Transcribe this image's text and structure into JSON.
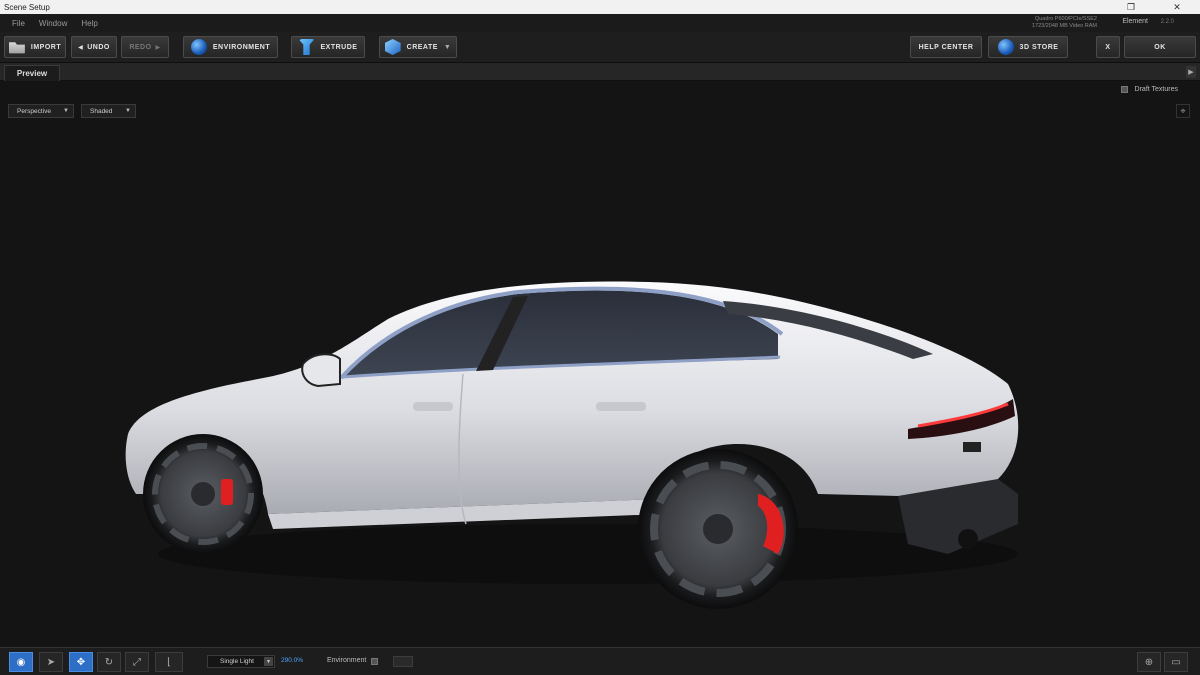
{
  "window": {
    "title": "Scene Setup",
    "restore_glyph": "❐",
    "close_glyph": "✕"
  },
  "menu": {
    "file": "File",
    "window": "Window",
    "help": "Help"
  },
  "status": {
    "gpu_line1": "Quadro P600/PCIe/SSE2",
    "gpu_line2": "1723/2048 MB Video RAM",
    "element": "Element",
    "version": "2.2.0"
  },
  "toolbar": {
    "import": "IMPORT",
    "undo": "UNDO",
    "redo": "REDO",
    "environment": "ENVIRONMENT",
    "extrude": "EXTRUDE",
    "create": "CREATE",
    "help_center": "HELP CENTER",
    "store": "3D STORE",
    "close": "X",
    "ok": "OK"
  },
  "tabs": {
    "preview": "Preview"
  },
  "viewport": {
    "draft_textures": "Draft Textures",
    "camera": "Perspective",
    "render_mode": "Shaded"
  },
  "bottom": {
    "light": "Single Light",
    "zoom": "290.0%",
    "environment": "Environment"
  },
  "icons": [
    "folder-icon",
    "globe-icon",
    "extrude-icon",
    "cube-icon",
    "camera-icon",
    "pointer-icon",
    "move-icon",
    "rotate-icon",
    "scale-icon",
    "axis-icon",
    "maximize-icon",
    "target-icon",
    "monitor-icon"
  ],
  "colors": {
    "accent_blue": "#2d6ec7",
    "zoom_link": "#4fa3ff",
    "brake_red": "#e02020"
  }
}
